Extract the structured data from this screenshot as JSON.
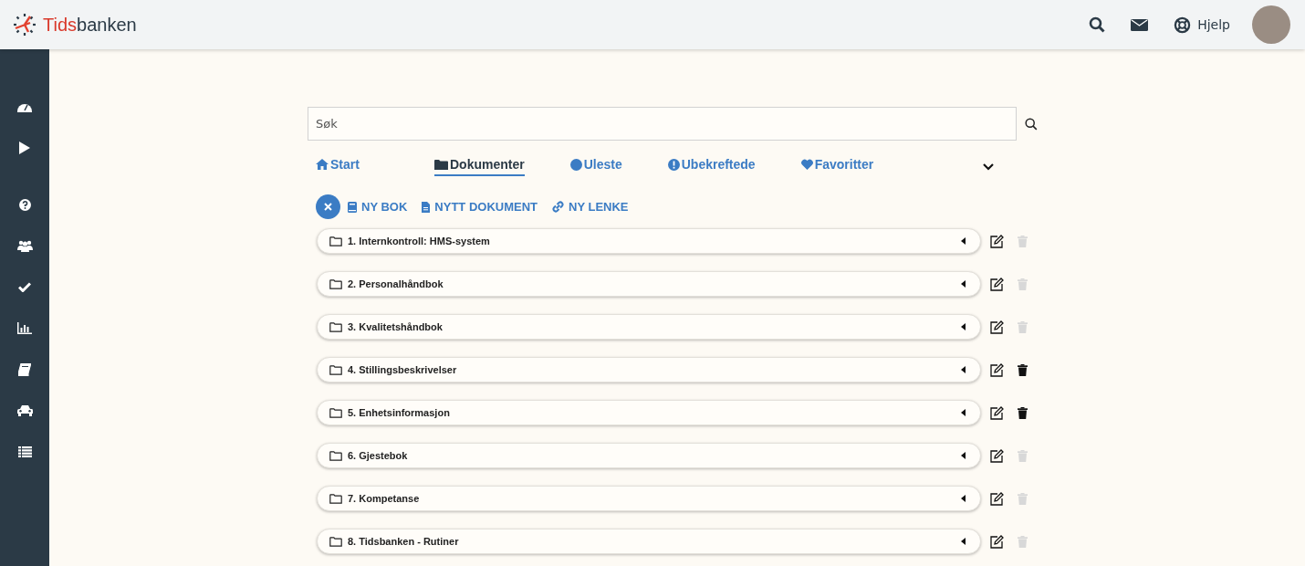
{
  "header": {
    "logo": {
      "accent": "Tids",
      "rest": "banken"
    },
    "help": "Hjelp"
  },
  "sidebar": {
    "items": [
      {
        "kind": "dashboard"
      },
      {
        "kind": "play"
      },
      {
        "kind": "question"
      },
      {
        "kind": "users"
      },
      {
        "kind": "check"
      },
      {
        "kind": "chart"
      },
      {
        "kind": "book"
      },
      {
        "kind": "car"
      },
      {
        "kind": "list"
      }
    ]
  },
  "search": {
    "placeholder": "Søk"
  },
  "tabs": [
    {
      "kind": "home",
      "label": "Start",
      "selected": false
    },
    {
      "kind": "folder",
      "label": "Dokumenter",
      "selected": true
    },
    {
      "kind": "circle",
      "label": "Uleste",
      "selected": false
    },
    {
      "kind": "alert",
      "label": "Ubekreftede",
      "selected": false
    },
    {
      "kind": "heart",
      "label": "Favoritter",
      "selected": false
    }
  ],
  "actions": [
    {
      "kind": "book",
      "label": "NY BOK"
    },
    {
      "kind": "file",
      "label": "NYTT DOKUMENT"
    },
    {
      "kind": "link",
      "label": "NY LENKE"
    }
  ],
  "folders": [
    {
      "label": "1. Internkontroll: HMS-system",
      "delete_enabled": false
    },
    {
      "label": "2. Personalhåndbok",
      "delete_enabled": false
    },
    {
      "label": "3. Kvalitetshåndbok",
      "delete_enabled": false
    },
    {
      "label": "4. Stillingsbeskrivelser",
      "delete_enabled": true
    },
    {
      "label": "5. Enhetsinformasjon",
      "delete_enabled": true
    },
    {
      "label": "6. Gjestebok",
      "delete_enabled": false
    },
    {
      "label": "7. Kompetanse",
      "delete_enabled": false
    },
    {
      "label": "8. Tidsbanken - Rutiner",
      "delete_enabled": false
    }
  ]
}
